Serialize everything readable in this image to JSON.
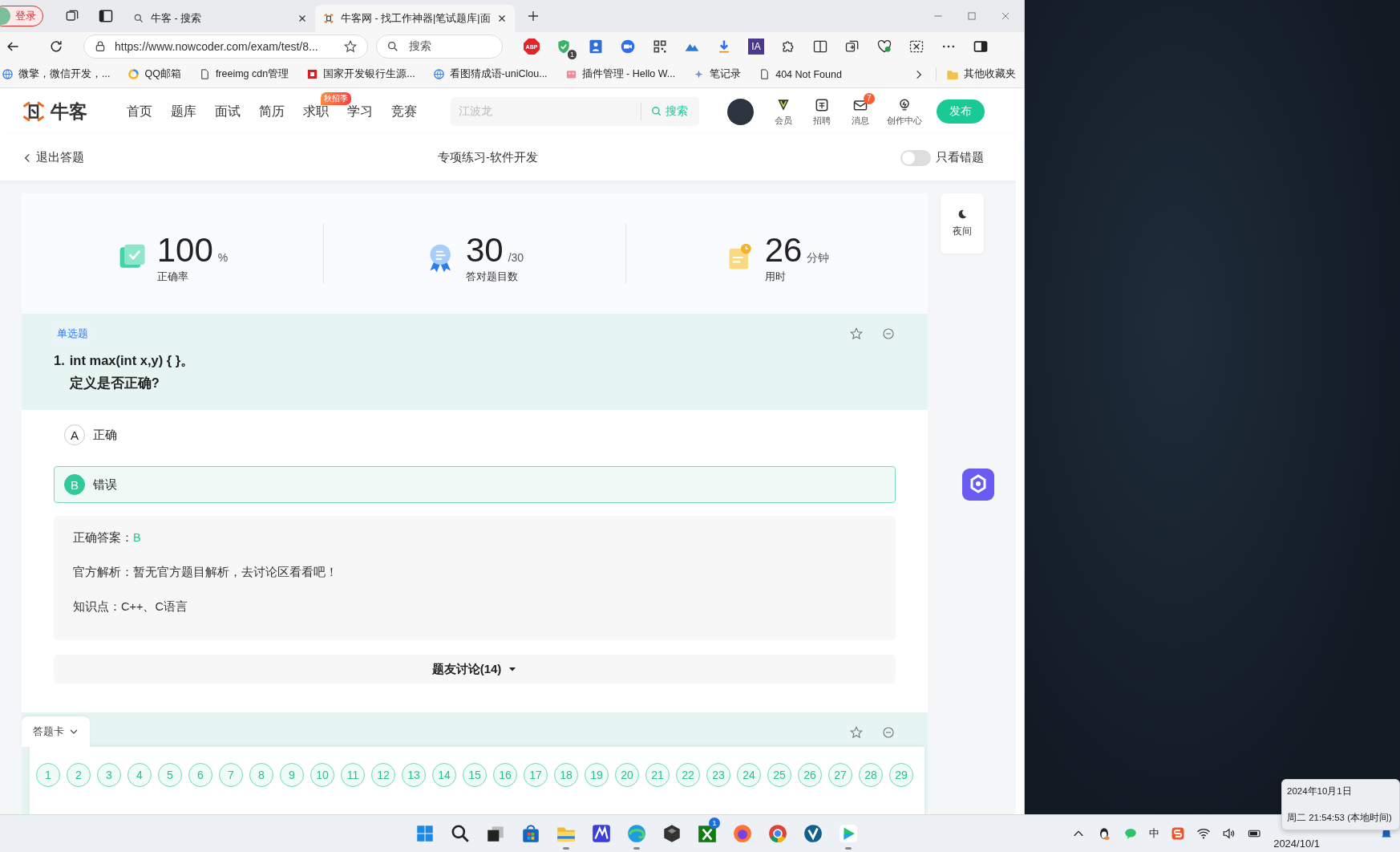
{
  "browser": {
    "profile_button": {
      "label": "登录"
    },
    "tabs": [
      {
        "title": "牛客 - 搜索",
        "selected": false
      },
      {
        "title": "牛客网 - 找工作神器|笔试题库|面",
        "selected": true
      }
    ],
    "address": "https://www.nowcoder.com/exam/test/8...",
    "search": {
      "placeholder": "搜索"
    },
    "extensions": [
      {
        "kind": "abp",
        "label": "ABP"
      },
      {
        "kind": "shield",
        "badge": "1"
      },
      {
        "kind": "person"
      },
      {
        "kind": "camera"
      },
      {
        "kind": "qr"
      },
      {
        "kind": "mountain"
      },
      {
        "kind": "download"
      },
      {
        "kind": "ia",
        "label": "IA"
      },
      {
        "kind": "puzzle"
      },
      {
        "kind": "split"
      },
      {
        "kind": "collections"
      },
      {
        "kind": "heart"
      },
      {
        "kind": "screenshot"
      },
      {
        "kind": "more"
      },
      {
        "kind": "sidebar"
      }
    ],
    "bookmarks": [
      {
        "kind": "globe",
        "label": "微擎，微信开发，..."
      },
      {
        "kind": "mail",
        "label": "QQ邮箱"
      },
      {
        "kind": "page",
        "label": "freeimg cdn管理"
      },
      {
        "kind": "bank",
        "label": "国家开发银行生源..."
      },
      {
        "kind": "globe",
        "label": "看图猜成语-uniClou..."
      },
      {
        "kind": "plugin",
        "label": "插件管理 - Hello W..."
      },
      {
        "kind": "star",
        "label": "笔记录"
      },
      {
        "kind": "page",
        "label": "404 Not Found"
      }
    ],
    "other_bookmarks": "其他收藏夹"
  },
  "site_header": {
    "logo": "牛客",
    "nav": [
      {
        "label": "首页"
      },
      {
        "label": "题库"
      },
      {
        "label": "面试"
      },
      {
        "label": "简历"
      },
      {
        "label": "求职",
        "badge": "秋招季"
      },
      {
        "label": "学习"
      },
      {
        "label": "竞赛"
      }
    ],
    "search": {
      "placeholder": "江波龙",
      "button": "搜索"
    },
    "tools": [
      {
        "kind": "vip",
        "label": "会员"
      },
      {
        "kind": "job",
        "label": "招聘"
      },
      {
        "kind": "message",
        "label": "消息",
        "badge": "7"
      },
      {
        "kind": "bulb",
        "label": "创作中心"
      }
    ],
    "publish": "发布"
  },
  "sub_header": {
    "back": "退出答题",
    "title": "专项练习-软件开发",
    "wrong_only": {
      "label": "只看错题",
      "on": false
    }
  },
  "stats": [
    {
      "kind": "accuracy",
      "value": "100",
      "unit": "%",
      "label": "正确率"
    },
    {
      "kind": "correct",
      "value": "30",
      "unit": "/30",
      "label": "答对题目数"
    },
    {
      "kind": "time",
      "value": "26",
      "unit": "分钟",
      "label": "用时"
    }
  ],
  "night_mode": {
    "label": "夜间"
  },
  "question": {
    "type": "单选题",
    "number": "1.",
    "lines": [
      "int max(int x,y) { }。",
      "定义是否正确?"
    ],
    "options": [
      {
        "letter": "A",
        "text": "正确",
        "selected": false
      },
      {
        "letter": "B",
        "text": "错误",
        "selected": true
      }
    ],
    "answer": {
      "label": "正确答案：",
      "value": "B"
    },
    "analysis": "官方解析：暂无官方题目解析，去讨论区看看吧！",
    "knowledge": "知识点：C++、C语言",
    "discussion": "题友讨论(14)"
  },
  "answer_card": {
    "label": "答题卡",
    "numbers": [
      "1",
      "2",
      "3",
      "4",
      "5",
      "6",
      "7",
      "8",
      "9",
      "10",
      "11",
      "12",
      "13",
      "14",
      "15",
      "16",
      "17",
      "18",
      "19",
      "20",
      "21",
      "22",
      "23",
      "24",
      "25",
      "26",
      "27",
      "28",
      "29"
    ]
  },
  "taskbar": {
    "apps": [
      {
        "kind": "start",
        "running": false
      },
      {
        "kind": "search",
        "running": false
      },
      {
        "kind": "taskview",
        "running": false
      },
      {
        "kind": "store",
        "running": false
      },
      {
        "kind": "explorer",
        "running": true
      },
      {
        "kind": "ribbon",
        "running": false
      },
      {
        "kind": "edge",
        "running": true
      },
      {
        "kind": "cube",
        "running": false
      },
      {
        "kind": "xbox",
        "running": false,
        "badge": "1"
      },
      {
        "kind": "firefox",
        "running": false
      },
      {
        "kind": "chrome",
        "running": false
      },
      {
        "kind": "vcheck",
        "running": false
      },
      {
        "kind": "player",
        "running": true
      }
    ],
    "tray": {
      "ime": "中",
      "clock": "2024/10/1"
    },
    "tooltip": [
      "2024年10月1日",
      "周二 21:54:53 (本地时间)"
    ]
  }
}
